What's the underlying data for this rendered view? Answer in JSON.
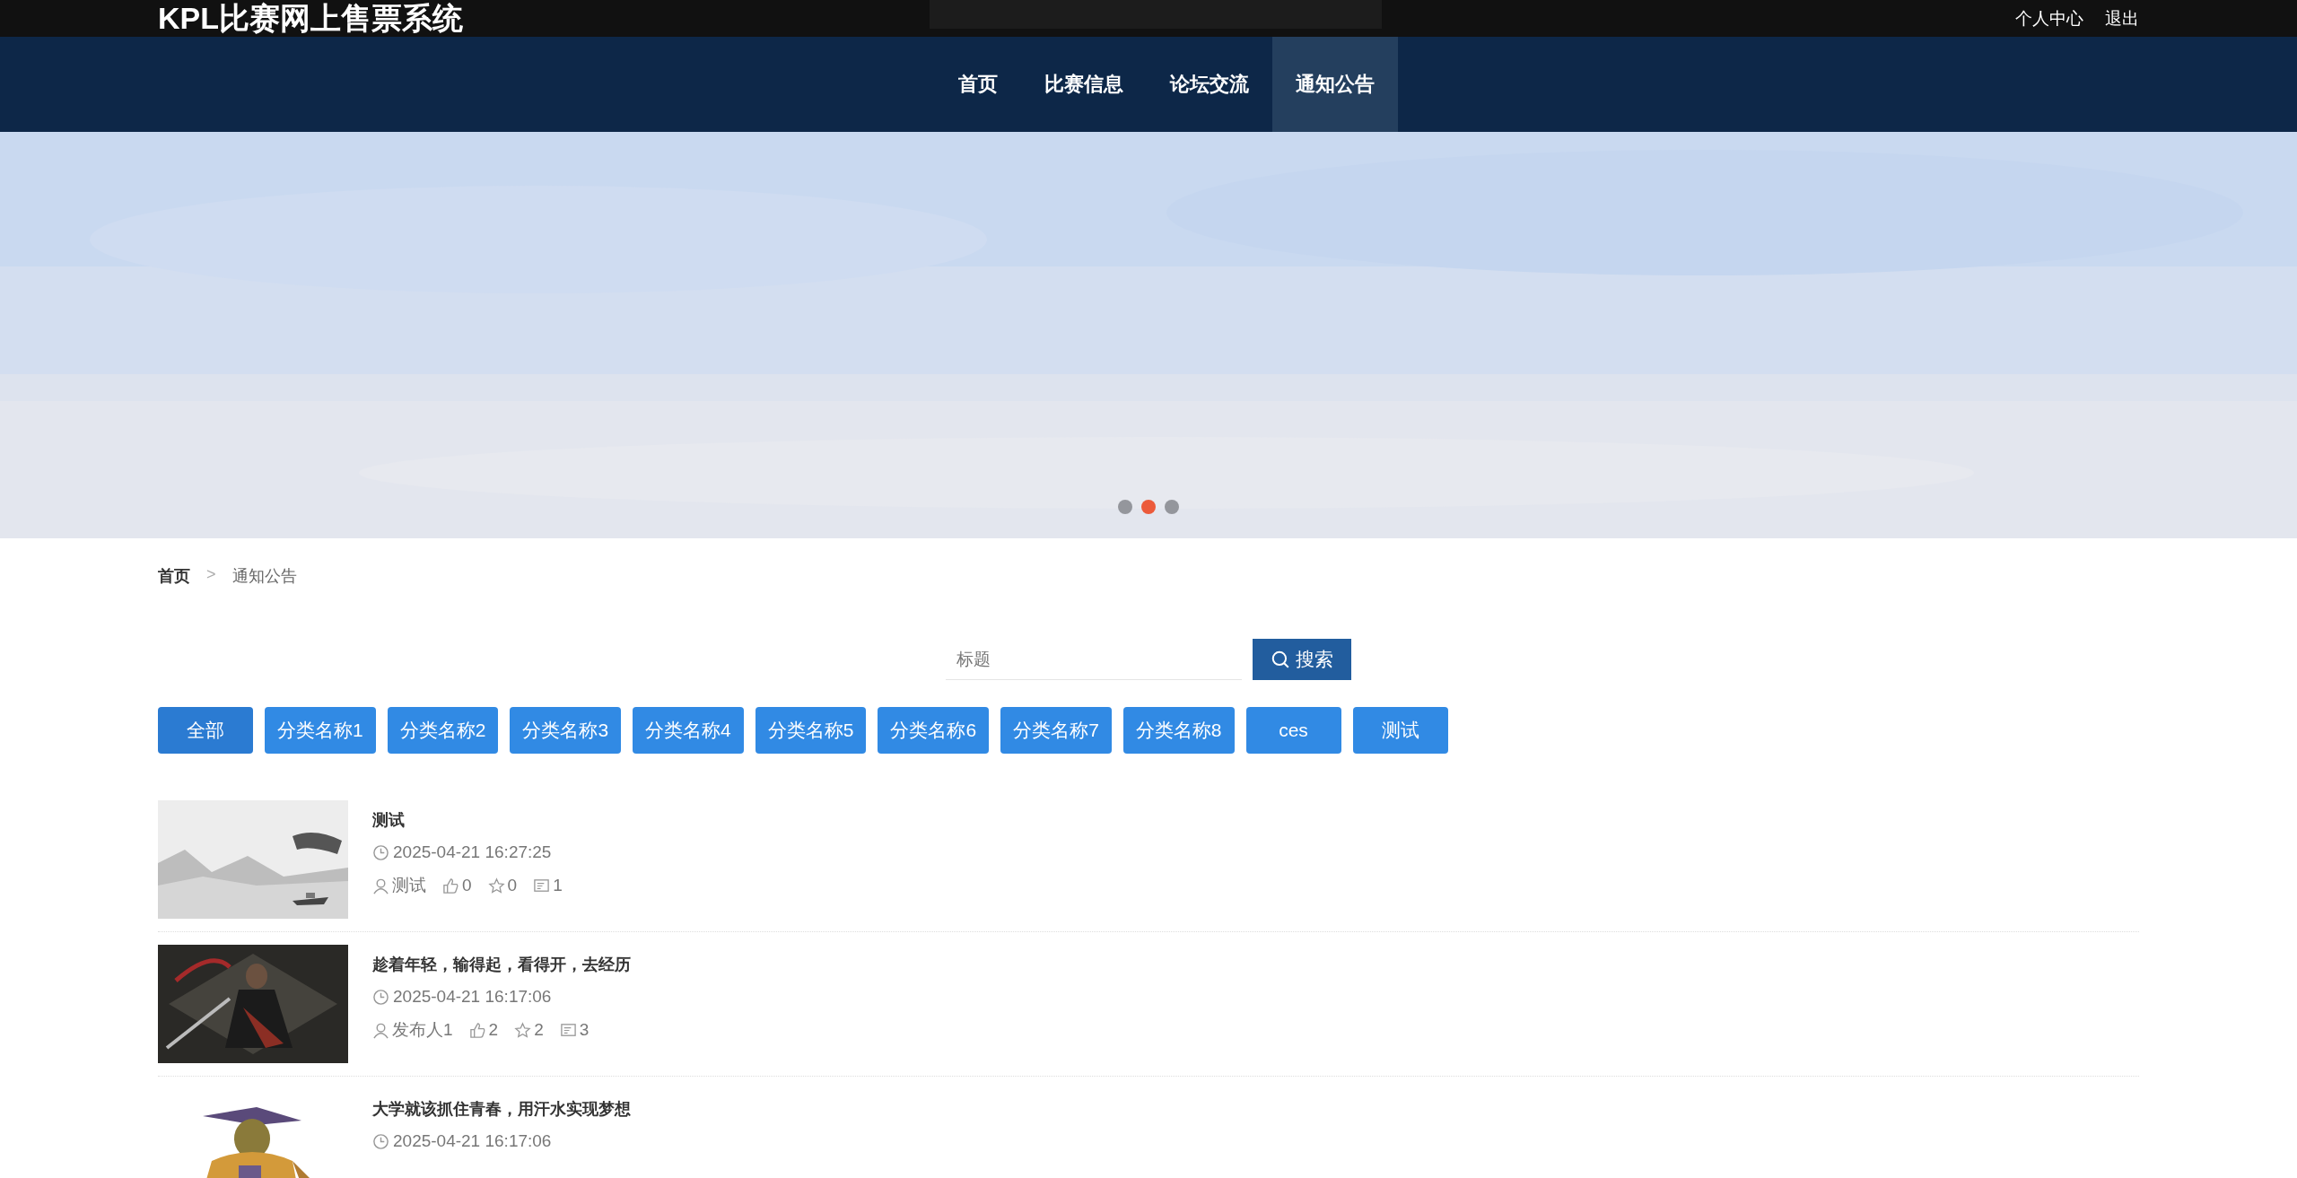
{
  "header": {
    "logo": "KPL比赛网上售票系统",
    "links": [
      "个人中心",
      "退出"
    ]
  },
  "nav": [
    {
      "label": "首页",
      "selected": false
    },
    {
      "label": "比赛信息",
      "selected": false
    },
    {
      "label": "论坛交流",
      "selected": false
    },
    {
      "label": "通知公告",
      "selected": true
    }
  ],
  "banner": {
    "kind": "picture",
    "dots": [
      {
        "selected": false
      },
      {
        "selected": true
      },
      {
        "selected": false
      }
    ]
  },
  "breadcrumb": [
    "首页",
    ">",
    "通知公告"
  ],
  "search": {
    "placeholder": "标题",
    "button": "搜索"
  },
  "categories": [
    {
      "label": "全部",
      "selected": true
    },
    {
      "label": "分类名称1",
      "selected": false
    },
    {
      "label": "分类名称2",
      "selected": false
    },
    {
      "label": "分类名称3",
      "selected": false
    },
    {
      "label": "分类名称4",
      "selected": false
    },
    {
      "label": "分类名称5",
      "selected": false
    },
    {
      "label": "分类名称6",
      "selected": false
    },
    {
      "label": "分类名称7",
      "selected": false
    },
    {
      "label": "分类名称8",
      "selected": false
    },
    {
      "label": "ces",
      "selected": false
    },
    {
      "label": "测试",
      "selected": false
    }
  ],
  "articles": [
    {
      "title": "测试",
      "time": "2025-04-21 16:27:25",
      "author": "测试",
      "likes": "0",
      "stars": "0",
      "comments": "1"
    },
    {
      "title": "趁着年轻，输得起，看得开，去经历",
      "time": "2025-04-21 16:17:06",
      "author": "发布人1",
      "likes": "2",
      "stars": "2",
      "comments": "3"
    },
    {
      "title": "大学就该抓住青春，用汗水实现梦想",
      "time": "2025-04-21 16:17:06"
    }
  ]
}
